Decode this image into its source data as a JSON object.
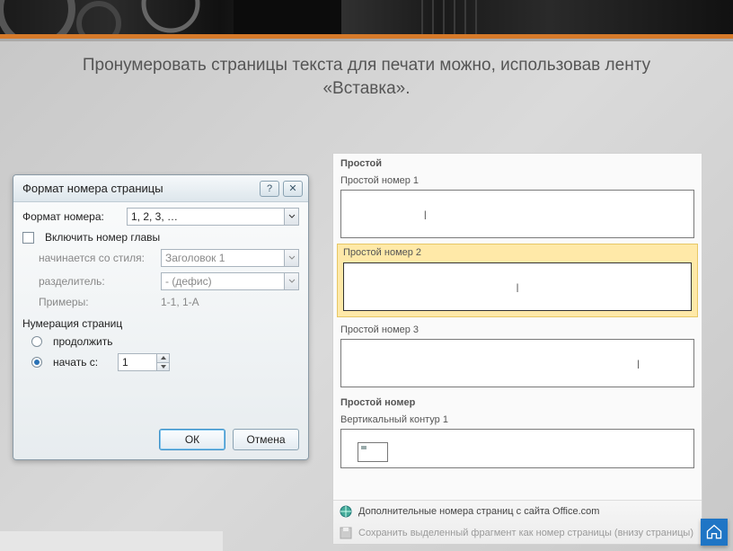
{
  "heading_l1": "Пронумеровать страницы текста для печати можно, использовав ленту",
  "heading_l2": "«Вставка».",
  "dialog": {
    "title": "Формат номера страницы",
    "format_label": "Формат номера:",
    "format_value": "1, 2, 3, …",
    "include_chapter": "Включить номер главы",
    "starts_with_style": "начинается со стиля:",
    "starts_with_value": "Заголовок 1",
    "separator_label": "разделитель:",
    "separator_value": "-   (дефис)",
    "examples_label": "Примеры:",
    "examples_value": "1-1, 1-A",
    "section_numbering": "Нумерация страниц",
    "continue": "продолжить",
    "start_at": "начать с:",
    "start_value": "1",
    "ok": "ОК",
    "cancel": "Отмена"
  },
  "gallery": {
    "group1": "Простой",
    "item1": "Простой номер 1",
    "item2": "Простой номер 2",
    "item3": "Простой номер 3",
    "group2": "Простой номер",
    "item4": "Вертикальный контур 1",
    "more": "Дополнительные номера страниц с сайта Office.com",
    "save": "Сохранить выделенный фрагмент как номер страницы (внизу страницы)"
  }
}
